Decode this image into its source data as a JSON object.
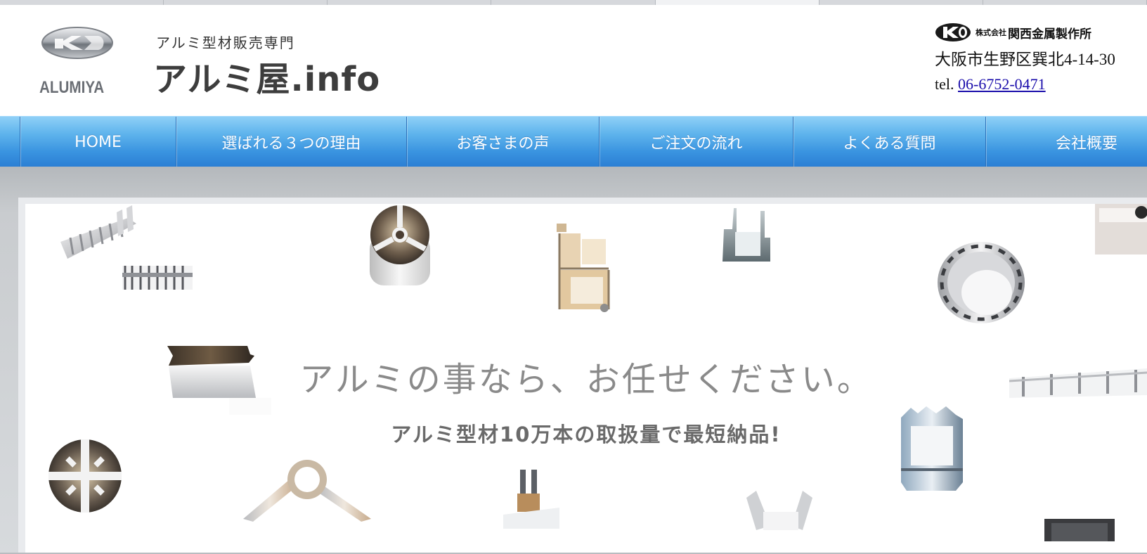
{
  "browser": {
    "tabs": [
      "",
      "",
      "",
      "",
      "",
      "",
      ""
    ],
    "active_tab_index": 4
  },
  "header": {
    "logo": {
      "wordmark": "ALUMIYA",
      "icon": "alumiya-k-emblem-icon"
    },
    "tagline": "アルミ型材販売専門",
    "site_title": "アルミ屋.info",
    "company": {
      "logo_icon": "kansai-k-logo-icon",
      "prefix": "株式会社",
      "name": "関西金属製作所",
      "address": "大阪市生野区巽北4-14-30",
      "tel_label": "tel.",
      "tel_number": "06-6752-0471"
    }
  },
  "nav": {
    "items": [
      {
        "label": "HOME"
      },
      {
        "label": "選ばれる３つの理由"
      },
      {
        "label": "お客さまの声"
      },
      {
        "label": "ご注文の流れ"
      },
      {
        "label": "よくある質問"
      },
      {
        "label": "会社概要"
      }
    ]
  },
  "hero": {
    "headline": "アルミの事なら、お任せください。",
    "subline": "アルミ型材10万本の取扱量で最短納品!",
    "product_images": [
      "aluminum-extrusion-finned-profile-icon",
      "aluminum-extrusion-round-pipe-icon",
      "aluminum-extrusion-door-frame-icon",
      "aluminum-extrusion-channel-icon",
      "aluminum-extrusion-square-tube-icon",
      "aluminum-extrusion-large-round-tube-icon",
      "aluminum-extrusion-flat-bar-icon",
      "aluminum-extrusion-cross-profile-icon",
      "aluminum-extrusion-angle-hinge-icon",
      "aluminum-extrusion-slot-profile-icon",
      "aluminum-extrusion-box-profile-icon",
      "aluminum-extrusion-rail-profile-icon"
    ]
  },
  "colors": {
    "nav_top": "#8fd0f7",
    "nav_bottom": "#2b7fd4",
    "title_text": "#3d3d3d",
    "link": "#1a0dab"
  }
}
